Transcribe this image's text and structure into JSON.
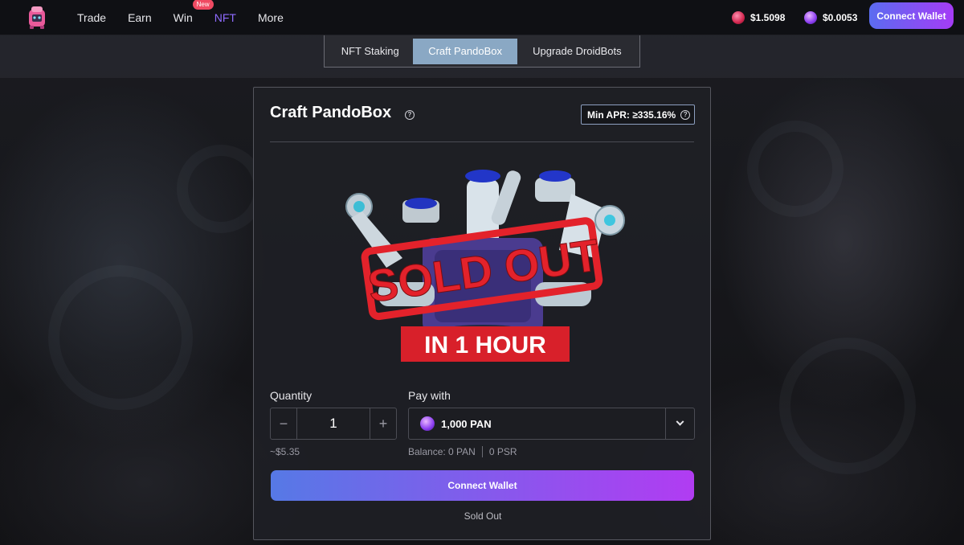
{
  "nav": {
    "items": [
      {
        "label": "Trade"
      },
      {
        "label": "Earn"
      },
      {
        "label": "Win",
        "badge": "New"
      },
      {
        "label": "NFT",
        "active": true
      },
      {
        "label": "More"
      }
    ]
  },
  "prices": {
    "psr": "$1.5098",
    "pan": "$0.0053"
  },
  "header": {
    "connect_label": "Connect Wallet"
  },
  "tabs": [
    "NFT Staking",
    "Craft PandoBox",
    "Upgrade DroidBots"
  ],
  "card": {
    "title": "Craft PandoBox",
    "apr": "Min APR: ≥335.16%",
    "stamp_text": "SOLD OUT",
    "banner_text": "IN 1 HOUR",
    "quantity_label": "Quantity",
    "quantity_value": "1",
    "usd_estimate": "~$5.35",
    "pay_label": "Pay with",
    "pay_value": "1,000 PAN",
    "balance_pan": "Balance: 0 PAN",
    "balance_psr": "0 PSR",
    "connect_label": "Connect Wallet",
    "status": "Sold Out"
  },
  "colors": {
    "accent": "#8f6bff",
    "badge": "#ef4a62",
    "stamp": "#e3222b",
    "active_tab": "#8aa8c4"
  }
}
